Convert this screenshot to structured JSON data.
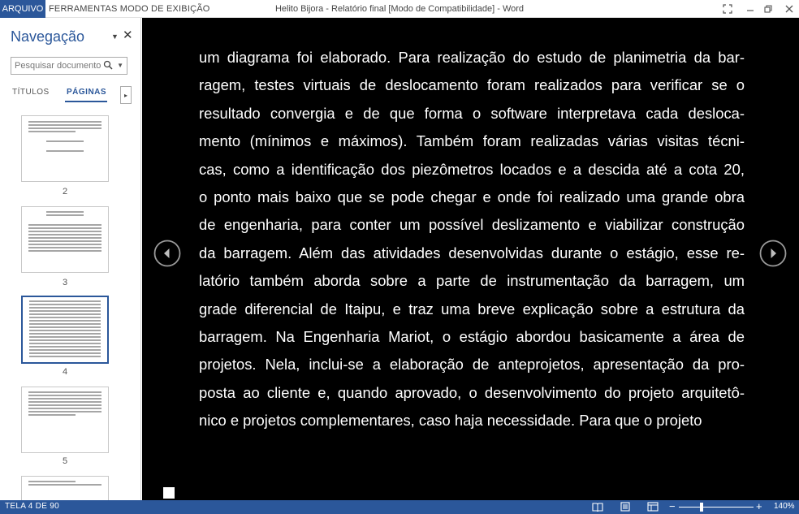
{
  "titlebar": {
    "file_tab": "ARQUIVO",
    "tools_tab": "FERRAMENTAS MODO DE EXIBIÇÃO",
    "window_title": "Helito Bijora - Relatório final [Modo de Compatibilidade] - Word"
  },
  "nav": {
    "title": "Navegação",
    "search_placeholder": "Pesquisar documento",
    "tab_titles": "TÍTULOS",
    "tab_pages": "PÁGINAS",
    "thumbnails": [
      {
        "page": "2",
        "selected": false
      },
      {
        "page": "3",
        "selected": false
      },
      {
        "page": "4",
        "selected": true
      },
      {
        "page": "5",
        "selected": false
      }
    ]
  },
  "document": {
    "lines": [
      "um diagrama foi elaborado. Para realização do estudo de planimetria da bar-",
      "ragem, testes virtuais de deslocamento foram realizados para verificar se o",
      "resultado convergia e de que forma o software interpretava cada desloca-",
      "mento (mínimos e máximos). Também foram realizadas várias visitas técni-",
      "cas, como a identificação dos piezômetros locados e a descida até a cota 20,",
      "o ponto mais baixo que se pode chegar e onde foi realizado uma grande obra",
      "de engenharia, para conter um possível deslizamento e viabilizar construção",
      "da barragem. Além das atividades desenvolvidas durante o estágio, esse re-",
      "latório também aborda sobre a parte de instrumentação da barragem, um",
      "grade diferencial de Itaipu, e traz uma breve explicação sobre a estrutura da",
      "barragem. Na Engenharia Mariot, o estágio abordou basicamente a área de",
      "projetos. Nela, inclui-se a elaboração de anteprojetos, apresentação da pro-",
      "posta ao cliente e, quando aprovado, o desenvolvimento do projeto arquitetô-",
      "nico e projetos complementares, caso haja necessidade. Para que o projeto"
    ]
  },
  "status": {
    "page_indicator": "TELA 4 DE 90",
    "zoom": "140%"
  },
  "colors": {
    "accent": "#2b579a",
    "reader_background": "#000000",
    "reader_text": "#ffffff"
  }
}
